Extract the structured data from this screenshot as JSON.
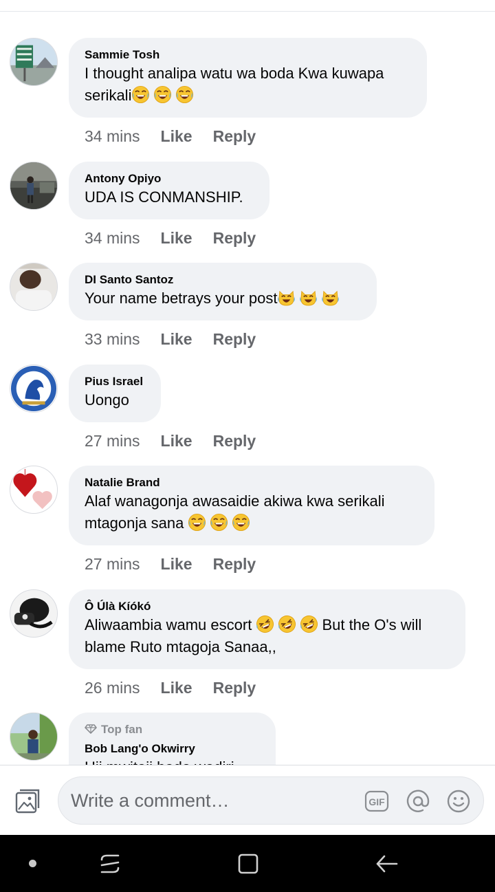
{
  "comments": [
    {
      "author": "Sammie Tosh",
      "lines": [
        "I thought analipa watu wa boda Kwa kuwapa",
        "serikali"
      ],
      "emoji": [
        "laugh-cry",
        "laugh-cry",
        "laugh-cry"
      ],
      "time": "34 mins",
      "like": "Like",
      "reply": "Reply"
    },
    {
      "author": "Antony Opiyo",
      "lines": [
        "UDA IS CONMANSHIP."
      ],
      "time": "34 mins",
      "like": "Like",
      "reply": "Reply"
    },
    {
      "author": "DI Santo Santoz",
      "lines": [
        "Your name betrays your post"
      ],
      "emoji": [
        "cat-joy",
        "cat-joy",
        "cat-joy"
      ],
      "time": "33 mins",
      "like": "Like",
      "reply": "Reply"
    },
    {
      "author": "Pius Israel",
      "lines": [
        "Uongo"
      ],
      "time": "27 mins",
      "like": "Like",
      "reply": "Reply"
    },
    {
      "author": "Natalie Brand",
      "lines": [
        "Alaf wanagonja awasaidie  akiwa kwa serikali",
        "mtagonja sana "
      ],
      "emoji": [
        "laugh-cry",
        "laugh-cry",
        "laugh-cry"
      ],
      "time": "27 mins",
      "like": "Like",
      "reply": "Reply"
    },
    {
      "author": "Ô Úlà Kíókó",
      "lines": [
        "Aliwaambia wamu escort ",
        "But the O's will",
        "blame Ruto mtagoja Sanaa,,"
      ],
      "emoji": [
        "rofl",
        "rofl",
        "rofl"
      ],
      "time": "26 mins",
      "like": "Like",
      "reply": "Reply"
    },
    {
      "badge": "Top fan",
      "author": "Bob Lang'o Okwirry",
      "lines": [
        "Hii mwitaji bado wadiri"
      ]
    }
  ],
  "composer": {
    "placeholder": "Write a comment…",
    "gif_label": "GIF"
  },
  "icons": [
    "photo-icon",
    "gif-icon",
    "mention-icon",
    "emoji-icon",
    "recents-icon",
    "home-icon",
    "back-icon"
  ]
}
